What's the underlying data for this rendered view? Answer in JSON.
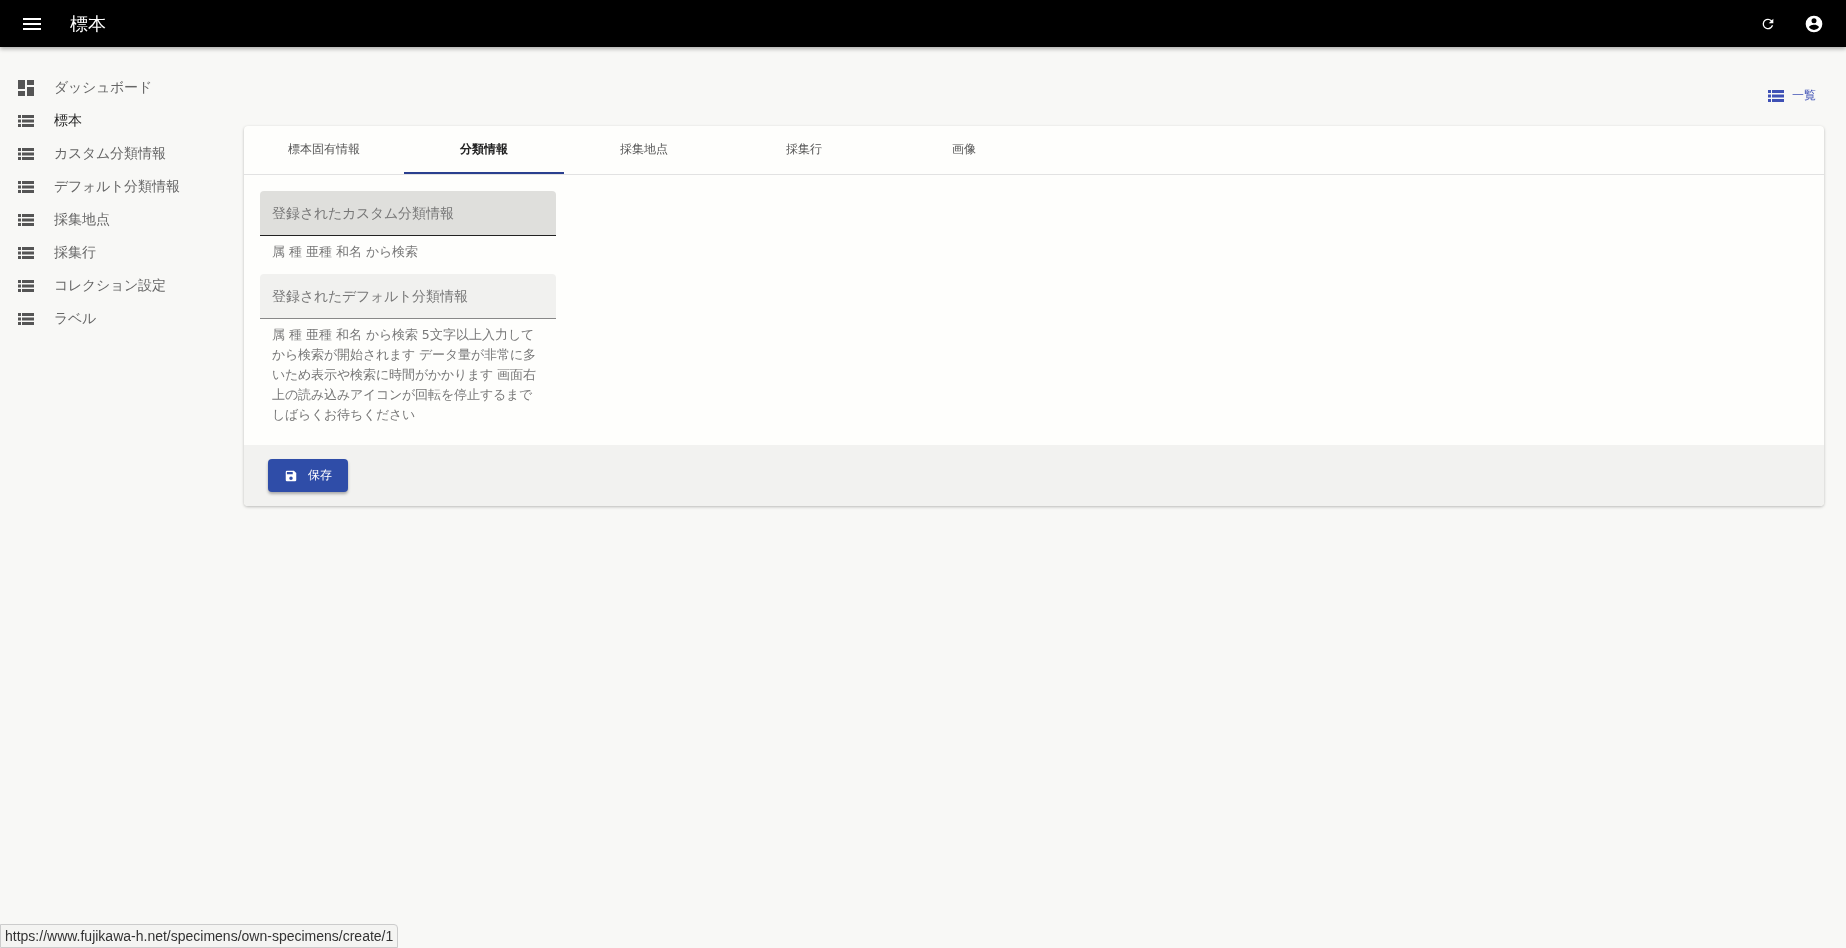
{
  "app_bar": {
    "title": "標本"
  },
  "sidebar": {
    "items": [
      {
        "label": "ダッシュボード",
        "kind": "dashboard",
        "selected": false
      },
      {
        "label": "標本",
        "kind": "list",
        "selected": true
      },
      {
        "label": "カスタム分類情報",
        "kind": "list",
        "selected": false
      },
      {
        "label": "デフォルト分類情報",
        "kind": "list",
        "selected": false
      },
      {
        "label": "採集地点",
        "kind": "list",
        "selected": false
      },
      {
        "label": "採集行",
        "kind": "list",
        "selected": false
      },
      {
        "label": "コレクション設定",
        "kind": "list",
        "selected": false
      },
      {
        "label": "ラベル",
        "kind": "list",
        "selected": false
      }
    ]
  },
  "list_link": {
    "label": "一覧"
  },
  "tabs": [
    {
      "label": "標本固有情報",
      "selected": false
    },
    {
      "label": "分類情報",
      "selected": true
    },
    {
      "label": "採集地点",
      "selected": false
    },
    {
      "label": "採集行",
      "selected": false
    },
    {
      "label": "画像",
      "selected": false
    }
  ],
  "fields": [
    {
      "placeholder": "登録されたカスタム分類情報",
      "hovered": true,
      "helper": "属 種 亜種 和名 から検索"
    },
    {
      "placeholder": "登録されたデフォルト分類情報",
      "hovered": false,
      "helper": "属 種 亜種 和名 から検索 5文字以上入力してから検索が開始されます データ量が非常に多いため表示や検索に時間がかかります 画面右上の読み込みアイコンが回転を停止するまでしばらくお待ちください"
    }
  ],
  "save_button": {
    "label": "保存"
  },
  "status_url": "https://www.fujikawa-h.net/specimens/own-specimens/create/1"
}
